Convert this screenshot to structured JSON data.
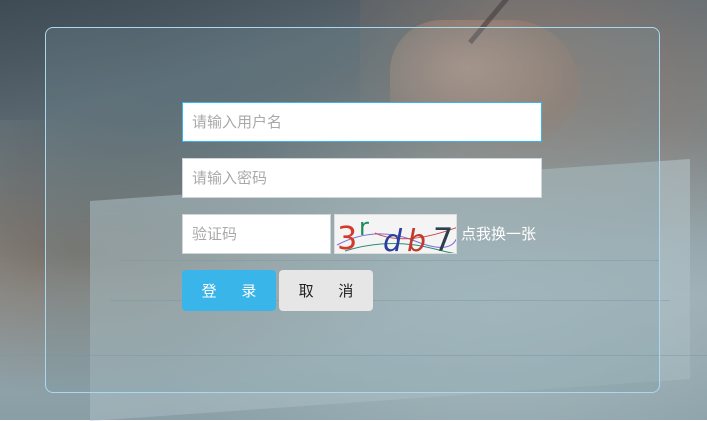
{
  "form": {
    "username_placeholder": "请输入用户名",
    "password_placeholder": "请输入密码",
    "captcha_placeholder": "验证码",
    "refresh_captcha_label": "点我换一张",
    "login_label": "登 录",
    "cancel_label": "取 消"
  },
  "captcha": {
    "chars": [
      "3",
      "r",
      "d",
      "b",
      "7"
    ],
    "char_colors": [
      "#d33a2c",
      "#1f8a5a",
      "#2a3f9e",
      "#c0392b",
      "#2c3e50"
    ]
  },
  "colors": {
    "accent": "#39b5ea",
    "panel_border": "#a9d9f0",
    "cancel_bg": "#e6e6e6"
  }
}
